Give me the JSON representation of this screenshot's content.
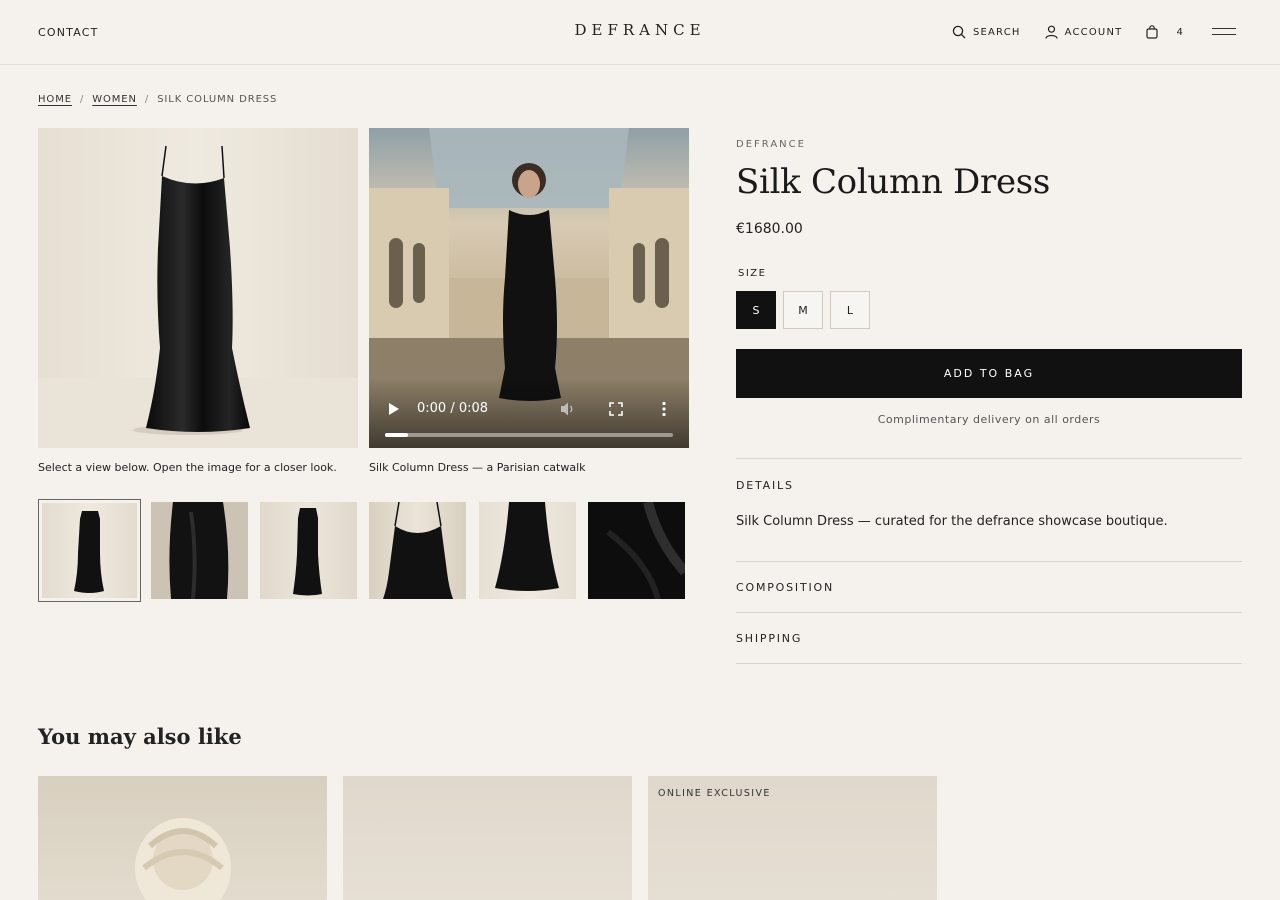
{
  "header": {
    "contact": "CONTACT",
    "logo": "DEFRANCE",
    "search": "SEARCH",
    "account": "ACCOUNT",
    "bag_count": "4"
  },
  "breadcrumb": {
    "home": "HOME",
    "women": "WOMEN",
    "current": "SILK COLUMN DRESS",
    "separator": "/"
  },
  "gallery": {
    "image_caption": "Select a view below. Open the image for a closer look.",
    "video_caption": "Silk Column Dress — a Parisian catwalk",
    "video_time": "0:00 / 0:08",
    "video_progress_fraction": 0.08,
    "thumbnails_count": 6,
    "active_thumbnail": 1
  },
  "product": {
    "brand": "DEFRANCE",
    "title": "Silk Column Dress",
    "price": "€1680.00",
    "size_label": "SIZE",
    "sizes": [
      "S",
      "M",
      "L"
    ],
    "selected_size": "S",
    "add_to_bag": "ADD TO BAG",
    "delivery_note": "Complimentary delivery on all orders",
    "details_title": "DETAILS",
    "details_text": "Silk Column Dress — curated for the defrance showcase boutique.",
    "composition_title": "COMPOSITION",
    "shipping_title": "SHIPPING"
  },
  "recommendations": {
    "title": "You may also like",
    "cards": [
      {
        "badge": ""
      },
      {
        "badge": ""
      },
      {
        "badge": "ONLINE EXCLUSIVE"
      }
    ]
  },
  "colors": {
    "background": "#f5f2ed",
    "text": "#1a1a1a",
    "button": "#111111"
  }
}
